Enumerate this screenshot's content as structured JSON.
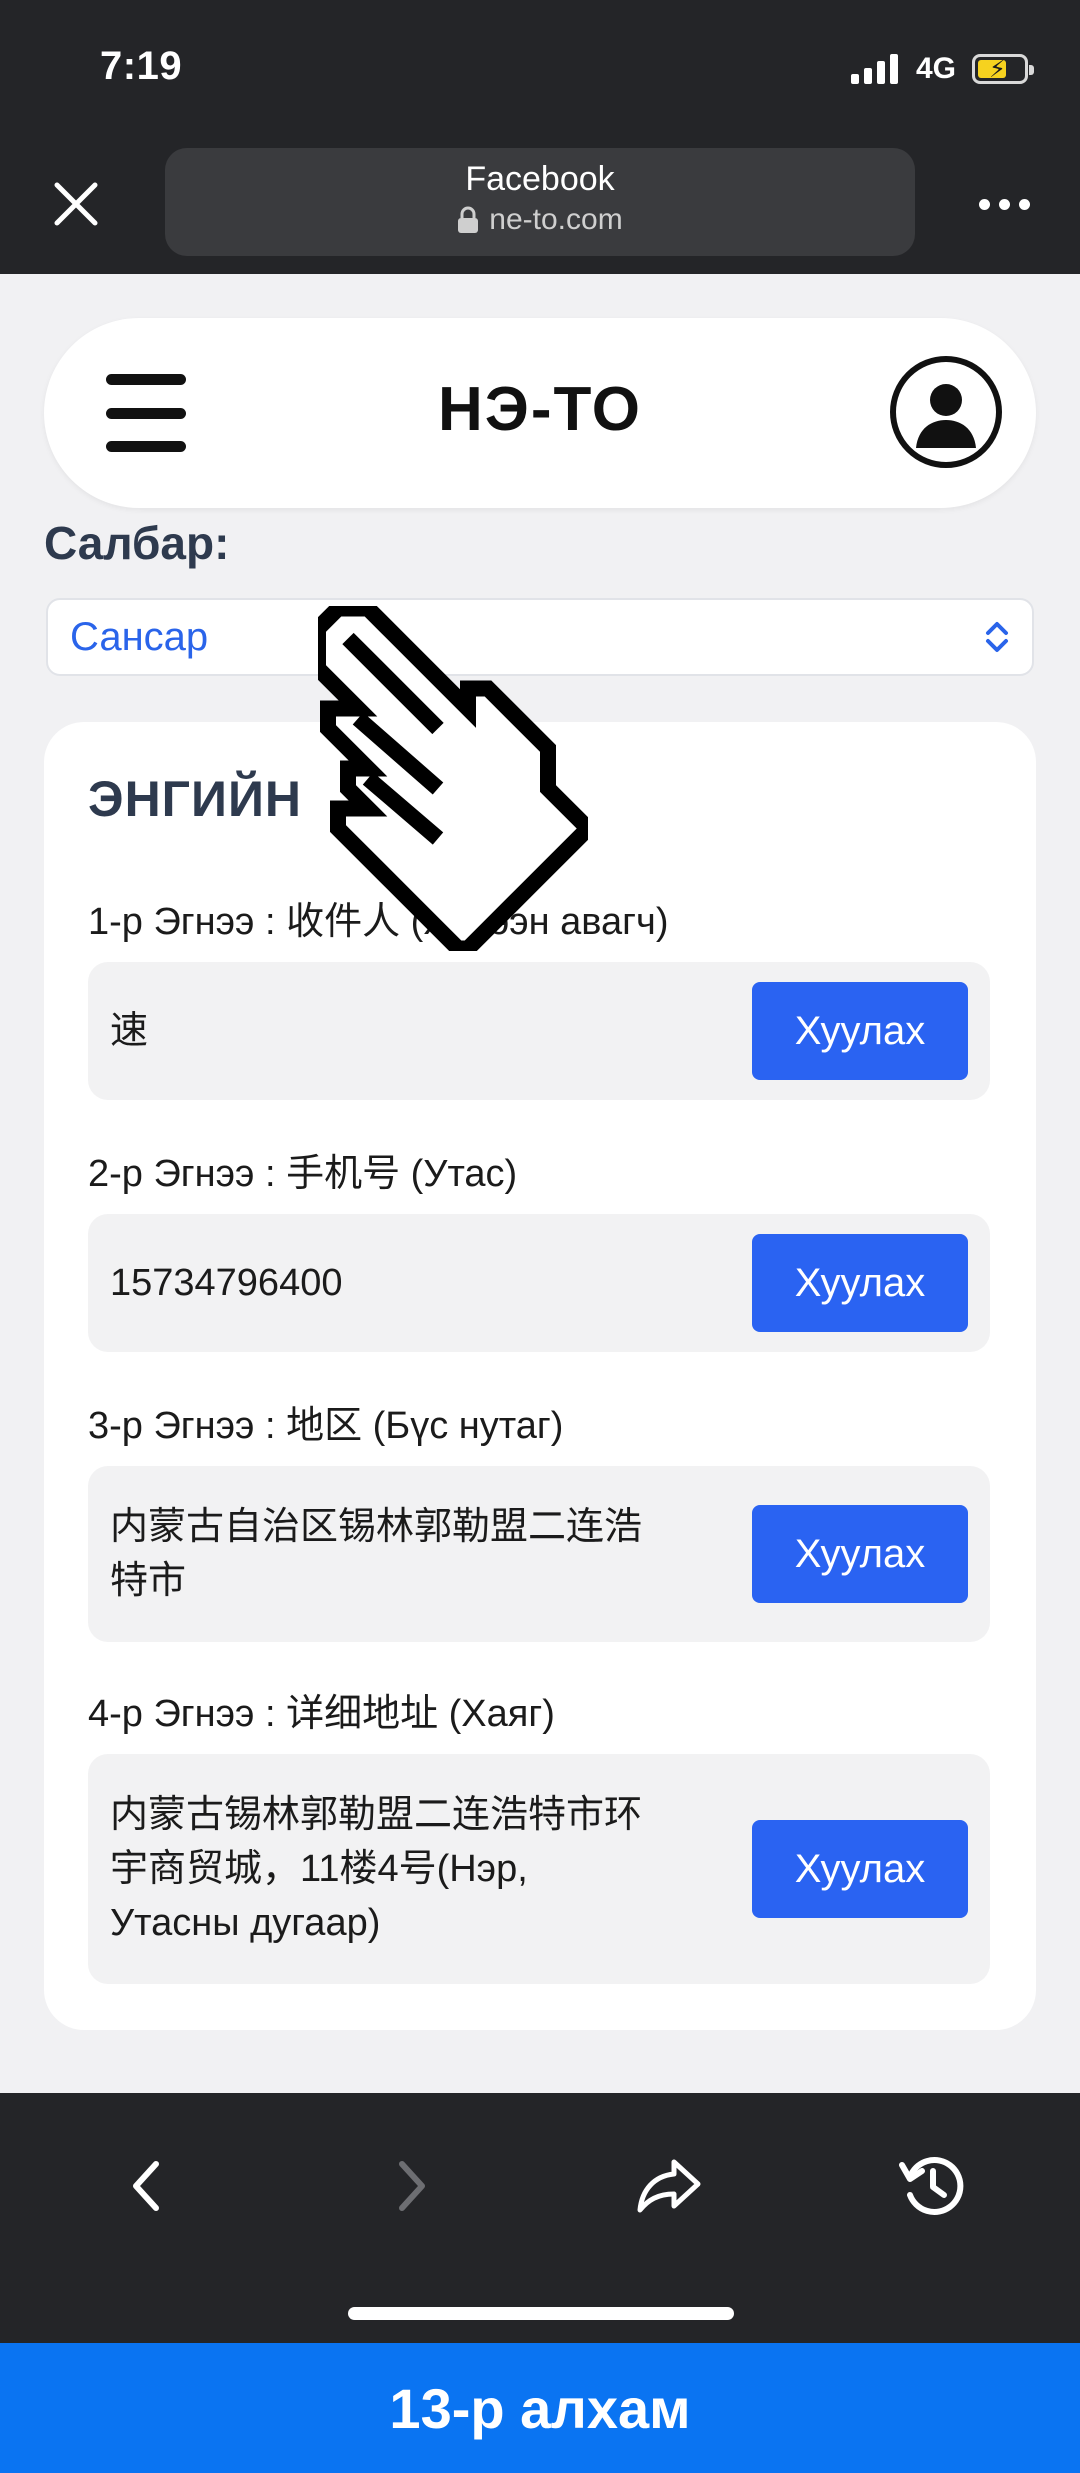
{
  "status_bar": {
    "time": "7:19",
    "network": "4G"
  },
  "browser": {
    "page_title": "Facebook",
    "domain": "ne-to.com"
  },
  "app": {
    "brand": "НЭ-ТО",
    "branch_label": "Салбар:",
    "branch_selected": "Сансар"
  },
  "card": {
    "title": "ЭНГИЙН",
    "rows": [
      {
        "label": "1-р Эгнээ : 收件人 (Хүлээн авагч)",
        "value": "速",
        "button": "Хуулах"
      },
      {
        "label": "2-р Эгнээ : 手机号 (Утас)",
        "value": "15734796400",
        "button": "Хуулах"
      },
      {
        "label": "3-р Эгнээ : 地区 (Бүс нутаг)",
        "value": "内蒙古自治区锡林郭勒盟二连浩\n特市",
        "button": "Хуулах"
      },
      {
        "label": "4-р Эгнээ : 详细地址 (Хаяг)",
        "value": "内蒙古锡林郭勒盟二连浩特市环\n宇商贸城，11楼4号(Нэр,\nУтасны дугаар)",
        "button": "Хуулах"
      }
    ]
  },
  "banner": {
    "text": "13-р алхам"
  },
  "colors": {
    "browser_chrome": "#242528",
    "accent_blue": "#2a63f2",
    "banner_blue": "#0a74f2",
    "select_text": "#2a64ea",
    "heading": "#2e3a4e"
  },
  "icons": [
    "close-icon",
    "lock-icon",
    "more-icon",
    "menu-icon",
    "user-icon",
    "select-arrows-icon",
    "hand-cursor-icon",
    "back-icon",
    "forward-icon",
    "share-icon",
    "history-icon"
  ]
}
